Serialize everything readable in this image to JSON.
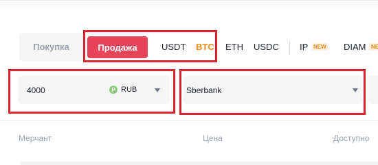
{
  "tabs": {
    "buy_label": "Покупка",
    "sell_label": "Продажа",
    "assets": [
      "USDT",
      "BTC",
      "ETH",
      "USDC",
      "IP",
      "DIAM"
    ],
    "active_asset": "BTC",
    "badges": {
      "ip": "NEW",
      "diam": "NE"
    }
  },
  "filters": {
    "amount": {
      "value": "4000",
      "currency": "RUB",
      "currency_icon": "P"
    },
    "payment": {
      "value": "Sberbank"
    }
  },
  "table": {
    "columns": [
      "Мерчант",
      "Цена",
      "Доступно"
    ]
  },
  "colors": {
    "accent": "#e9455a",
    "highlight": "#d8262f",
    "active_asset": "#f0891c"
  },
  "icons": {
    "amount_caret": "chevron-down-icon",
    "payment_caret": "chevron-down-icon",
    "currency": "ruble-icon"
  }
}
